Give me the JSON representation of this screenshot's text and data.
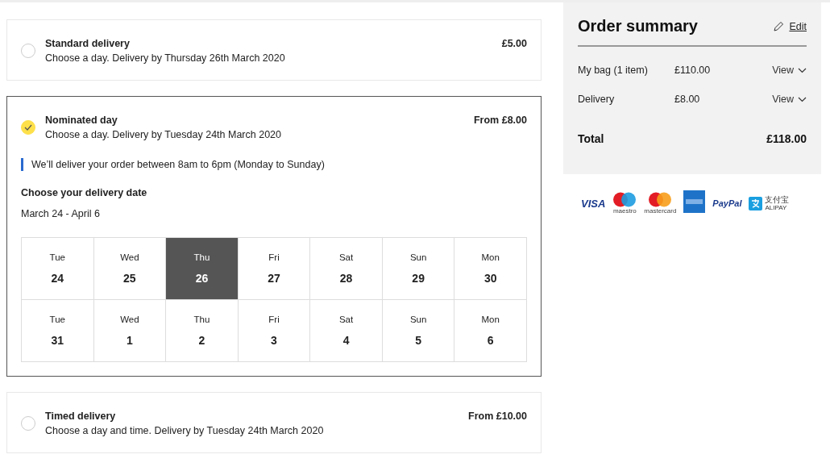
{
  "delivery_options": [
    {
      "title": "Standard delivery",
      "description": "Choose a day. Delivery by Thursday 26th March 2020",
      "price": "£5.00",
      "selected": false
    },
    {
      "title": "Nominated day",
      "description": "Choose a day. Delivery by Tuesday 24th March 2020",
      "price": "From £8.00",
      "selected": true,
      "note": "We’ll deliver your order between 8am to 6pm (Monday to Sunday)",
      "date_heading": "Choose your delivery date",
      "date_range": "March 24 - April 6",
      "dates": [
        {
          "weekday": "Tue",
          "day": "24",
          "selected": false
        },
        {
          "weekday": "Wed",
          "day": "25",
          "selected": false
        },
        {
          "weekday": "Thu",
          "day": "26",
          "selected": true
        },
        {
          "weekday": "Fri",
          "day": "27",
          "selected": false
        },
        {
          "weekday": "Sat",
          "day": "28",
          "selected": false
        },
        {
          "weekday": "Sun",
          "day": "29",
          "selected": false
        },
        {
          "weekday": "Mon",
          "day": "30",
          "selected": false
        },
        {
          "weekday": "Tue",
          "day": "31",
          "selected": false
        },
        {
          "weekday": "Wed",
          "day": "1",
          "selected": false
        },
        {
          "weekday": "Thu",
          "day": "2",
          "selected": false
        },
        {
          "weekday": "Fri",
          "day": "3",
          "selected": false
        },
        {
          "weekday": "Sat",
          "day": "4",
          "selected": false
        },
        {
          "weekday": "Sun",
          "day": "5",
          "selected": false
        },
        {
          "weekday": "Mon",
          "day": "6",
          "selected": false
        }
      ]
    },
    {
      "title": "Timed delivery",
      "description": "Choose a day and time. Delivery by Tuesday 24th March 2020",
      "price": "From £10.00",
      "selected": false
    }
  ],
  "order_summary": {
    "title": "Order summary",
    "edit": "Edit",
    "lines": [
      {
        "label": "My bag (1 item)",
        "amount": "£110.00",
        "action": "View"
      },
      {
        "label": "Delivery",
        "amount": "£8.00",
        "action": "View"
      }
    ],
    "total_label": "Total",
    "total": "£118.00"
  },
  "payment_methods": [
    {
      "kind": "visa",
      "text": "VISA"
    },
    {
      "kind": "maestro",
      "text": "maestro"
    },
    {
      "kind": "mastercard",
      "text": "mastercard"
    },
    {
      "kind": "amex"
    },
    {
      "kind": "paypal",
      "text": "PayPal"
    },
    {
      "kind": "alipay",
      "text": "支付宝",
      "subtext": "ALIPAY"
    }
  ]
}
